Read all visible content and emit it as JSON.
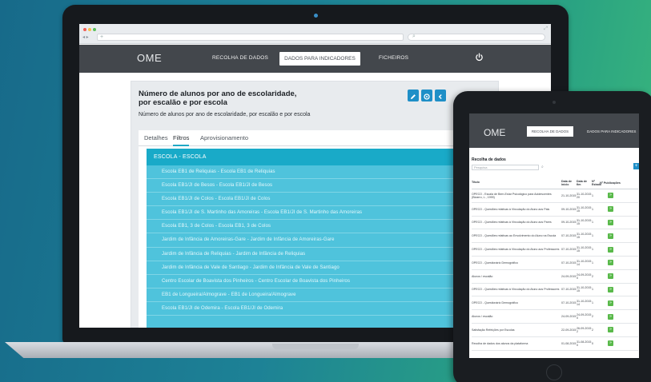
{
  "laptop": {
    "browser": {
      "traffic_lights": [
        "close",
        "minimize",
        "maximize"
      ]
    },
    "nav": {
      "logo": "OME",
      "links": [
        "RECOLHA DE DADOS",
        "DADOS PARA INDICADORES",
        "FICHEIROS"
      ],
      "active": "DADOS PARA INDICADORES"
    },
    "card": {
      "title": "Número de alunos por ano de escolaridade, por escalão e por escola",
      "subtitle": "Número de alunos por ano de escolaridade, por escalão e por escola",
      "tabs": [
        "Detalhes",
        "Filtros",
        "Aprovisionamento"
      ],
      "active_tab": "Filtros",
      "filter_header": "ESCOLA - ESCOLA",
      "filter_items": [
        "Escola EB1 de Reliquias - Escola EB1 de Reliquias",
        "Escola EB1/JI de Besos - Escola EB1/JI de Besos",
        "Escola EB1/JI de Colos - Escola EB1/JI de Colos",
        "Escola EB1/JI de S. Martinho das Amoreiras - Escola EB1/JI de S. Martinho das Amoreiras",
        "Escola EB1, 3 de Colos - Escola EB1, 3 de Colos",
        "Jardim de Infância de Amoreiras-Gare - Jardim de Infância de Amoreiras-Gare",
        "Jardim de Infância de Reliquias - Jardim de Infância de Reliquias",
        "Jardim de Infância de Vale de Santiago - Jardim de Infância de Vale de Santiago",
        "Centro Escolar de Boavista dos Pinheiros - Centro Escolar de Boavista dos Pinheiros",
        "EB1 de Longueira/Almograve - EB1 de Longueira/Almograve",
        "Escola EB1/JI de Odemira - Escola EB1/JI de Odemira"
      ]
    }
  },
  "tablet": {
    "nav": {
      "logo": "OME",
      "active": "RECOLHA DE DADOS",
      "other": "DADOS PARA INDICADORES"
    },
    "heading": "Recolha de dados",
    "search_placeholder": "Pesquisa",
    "add_label": "+",
    "go_label": "»",
    "columns": [
      "Título",
      "Data de início",
      "Data de fim",
      "Nº Estado",
      "Nº Publicações"
    ],
    "rows": [
      {
        "title": "OPECO - Escala de Bem-Estar Psicológico para Adolescentes (Bizarro, L., 1999)",
        "start": "21-10-2015",
        "end": "31-10-2015 20",
        "n": "1"
      },
      {
        "title": "OPECO - Questões relativas à Vinculação do Aluno aos Pais",
        "start": "09-10-2015",
        "end": "31-10-2015 15",
        "n": "1"
      },
      {
        "title": "OPECO - Questões relativas à Vinculação do Aluno aos Pares",
        "start": "09-10-2015",
        "end": "31-10-2015 15",
        "n": "1"
      },
      {
        "title": "OPECO - Questões relativas ao Envolvimento do Aluno na Escola",
        "start": "07-10-2015",
        "end": "31-10-2015 15",
        "n": "1"
      },
      {
        "title": "OPECO - Questões relativas à Vinculação do Aluno aos Professores",
        "start": "07-10-2015",
        "end": "31-10-2015 15",
        "n": "1"
      },
      {
        "title": "OPECO - Questionário Demográfico",
        "start": "07-10-2015",
        "end": "31-10-2015 14",
        "n": "1"
      },
      {
        "title": "Alunos / escalão",
        "start": "24-09-2015",
        "end": "24-09-2015 0",
        "n": "2"
      },
      {
        "title": "OPECO - Questões relativas à Vinculação do Aluno aos Professores",
        "start": "07-10-2015",
        "end": "31-10-2015 15",
        "n": "1"
      },
      {
        "title": "OPECO - Questionário Demográfico",
        "start": "07-10-2015",
        "end": "31-10-2015 14",
        "n": "1"
      },
      {
        "title": "Alunos / escalão",
        "start": "24-09-2015",
        "end": "24-09-2015 0",
        "n": "2"
      },
      {
        "title": "Satisfação Refeições por Escolas",
        "start": "22-09-2015",
        "end": "26-09-2015 2",
        "n": "2"
      },
      {
        "title": "Recolha de dados dos alunos da plataforma",
        "start": "01-08-2015",
        "end": "31-08-2015 0",
        "n": "0"
      }
    ]
  },
  "colors": {
    "accent": "#1f8fc7",
    "filter_header": "#19aac8",
    "filter_body": "#4fc3dc",
    "nav_bg": "#43474c",
    "go_button": "#59b94a"
  }
}
